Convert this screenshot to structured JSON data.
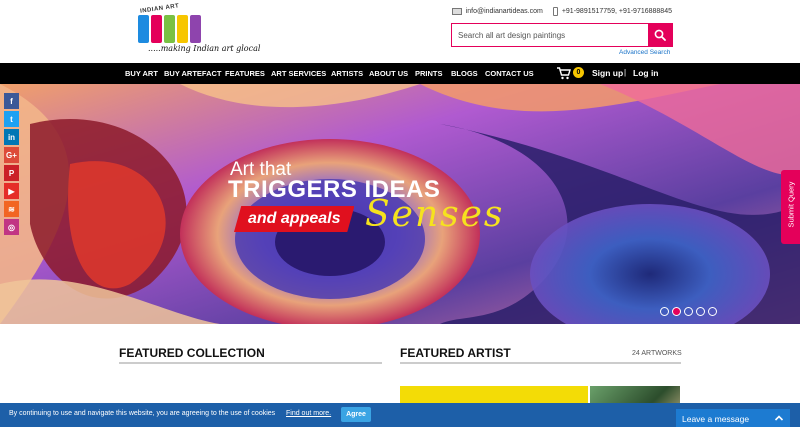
{
  "header": {
    "logo": {
      "top_text": "INDIAN ART",
      "word": "IDEAS",
      "tagline": ".....making Indian art glocal",
      "block_colors": [
        "#1d8be0",
        "#e4005a",
        "#7ac143",
        "#f7c600",
        "#8e44ad"
      ]
    },
    "email": "info@indianartideas.com",
    "phone": "+91-9891517759, +91-9716888845",
    "search": {
      "placeholder": "Search all art design paintings",
      "value": ""
    },
    "advanced_search": "Advanced Search"
  },
  "nav": {
    "items": [
      "BUY ART",
      "BUY ARTEFACT",
      "FEATURES",
      "ART SERVICES",
      "ARTISTS",
      "ABOUT US",
      "PRINTS",
      "BLOGS",
      "CONTACT US"
    ],
    "cart_count": "0",
    "signup": "Sign up",
    "separator": "|",
    "login": "Log in"
  },
  "banner": {
    "line1": "Art that",
    "line2": "TRIGGERS IDEAS",
    "tag": "and appeals",
    "script": "Senses",
    "slides": 5,
    "active_slide": 2
  },
  "social": [
    {
      "name": "facebook",
      "glyph": "f",
      "color": "#3b5998"
    },
    {
      "name": "twitter",
      "glyph": "t",
      "color": "#1da1f2"
    },
    {
      "name": "linkedin",
      "glyph": "in",
      "color": "#0077b5"
    },
    {
      "name": "google-plus",
      "glyph": "G+",
      "color": "#dd4b39"
    },
    {
      "name": "pinterest",
      "glyph": "P",
      "color": "#cb2027"
    },
    {
      "name": "youtube",
      "glyph": "▶",
      "color": "#e52d27"
    },
    {
      "name": "rss",
      "glyph": "≋",
      "color": "#f26522"
    },
    {
      "name": "instagram",
      "glyph": "◎",
      "color": "#c13584"
    }
  ],
  "submit_query": "Submit Query",
  "featured": {
    "collection_title": "FEATURED COLLECTION",
    "artist_title": "FEATURED ARTIST",
    "artworks_count": "24 ARTWORKS"
  },
  "cookie": {
    "text": "By continuing to use and navigate this website, you are agreeing to the use of cookies",
    "link": "Find out more.",
    "agree": "Agree"
  },
  "chat": {
    "label": "Leave a message"
  },
  "colors": {
    "accent": "#e4005a",
    "nav_bg": "#000000",
    "cookie_bg": "#1d5fa8"
  }
}
